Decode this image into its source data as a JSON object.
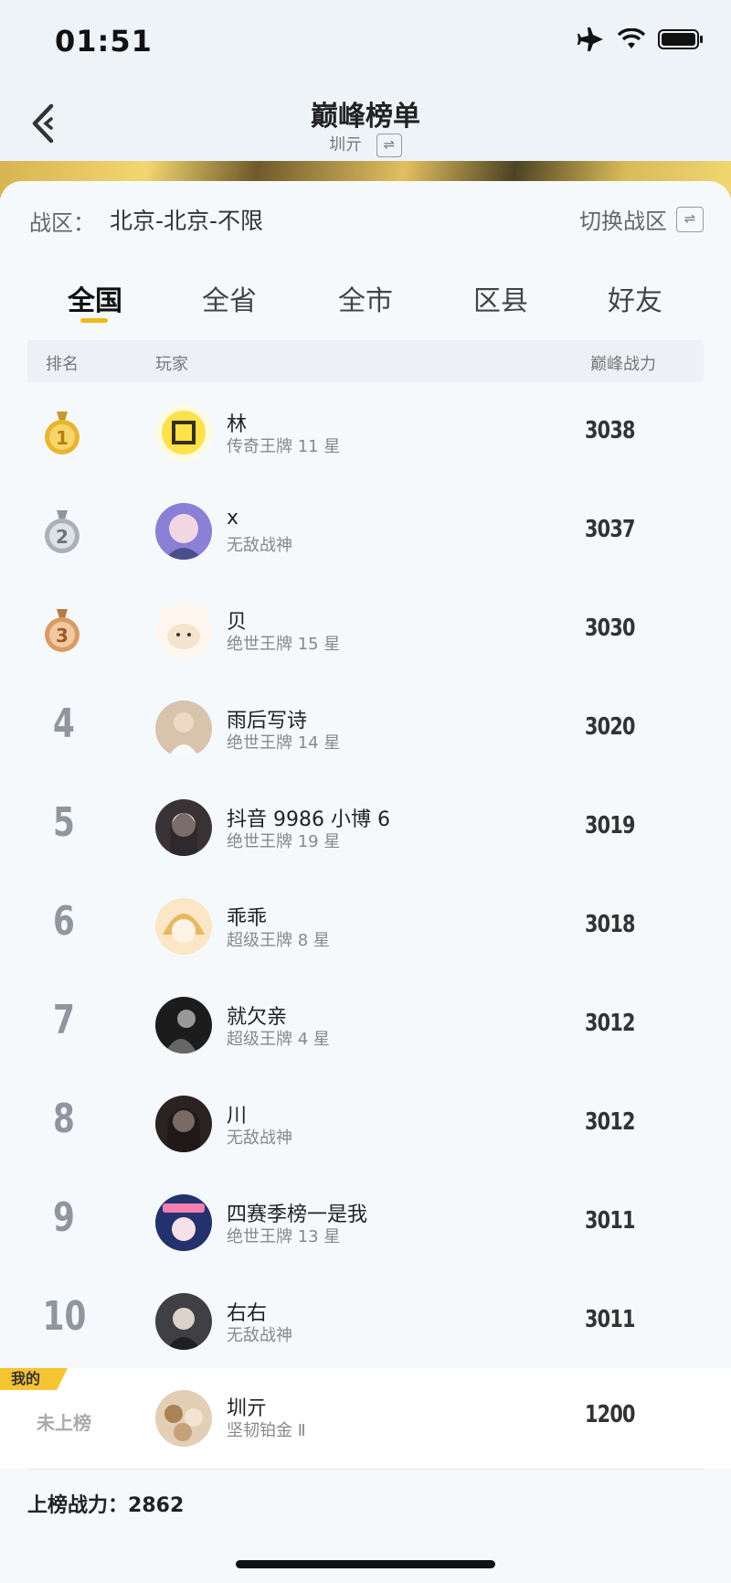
{
  "status_bar": {
    "time": "01:51"
  },
  "header": {
    "title": "巅峰榜单",
    "subtitle": "圳亓",
    "swap_glyph": "⇌"
  },
  "zone": {
    "label": "战区：",
    "value": "北京-北京-不限",
    "switch_label": "切换战区",
    "swap_glyph": "⇌"
  },
  "tabs": [
    {
      "label": "全国",
      "active": true
    },
    {
      "label": "全省",
      "active": false
    },
    {
      "label": "全市",
      "active": false
    },
    {
      "label": "区县",
      "active": false
    },
    {
      "label": "好友",
      "active": false
    }
  ],
  "table_header": {
    "rank": "排名",
    "player": "玩家",
    "power": "巅峰战力"
  },
  "rows": [
    {
      "rank": "1",
      "name": "林",
      "title": "传奇王牌 11 星",
      "power": "3038",
      "medal": "gold"
    },
    {
      "rank": "2",
      "name": "x",
      "title": "无敌战神",
      "power": "3037",
      "medal": "silver"
    },
    {
      "rank": "3",
      "name": "贝",
      "title": "绝世王牌 15 星",
      "power": "3030",
      "medal": "bronze"
    },
    {
      "rank": "4",
      "name": "雨后写诗",
      "title": "绝世王牌 14 星",
      "power": "3020"
    },
    {
      "rank": "5",
      "name": "抖音 9986 小博 6",
      "title": "绝世王牌 19 星",
      "power": "3019"
    },
    {
      "rank": "6",
      "name": "乖乖",
      "title": "超级王牌 8 星",
      "power": "3018"
    },
    {
      "rank": "7",
      "name": "就欠亲",
      "title": "超级王牌 4 星",
      "power": "3012"
    },
    {
      "rank": "8",
      "name": "川",
      "title": "无敌战神",
      "power": "3012"
    },
    {
      "rank": "9",
      "name": "四赛季榜一是我",
      "title": "绝世王牌 13 星",
      "power": "3011"
    },
    {
      "rank": "10",
      "name": "右右",
      "title": "无敌战神",
      "power": "3011"
    }
  ],
  "mine": {
    "tag": "我的",
    "rank_text": "未上榜",
    "name": "圳亓",
    "title": "坚韧铂金 Ⅱ",
    "power": "1200"
  },
  "footer": {
    "label": "上榜战力：",
    "value": "2862"
  },
  "colors": {
    "accent": "#f2b71c",
    "gold": "#e9b530",
    "silver": "#a9b0b8",
    "bronze": "#d99a63"
  }
}
